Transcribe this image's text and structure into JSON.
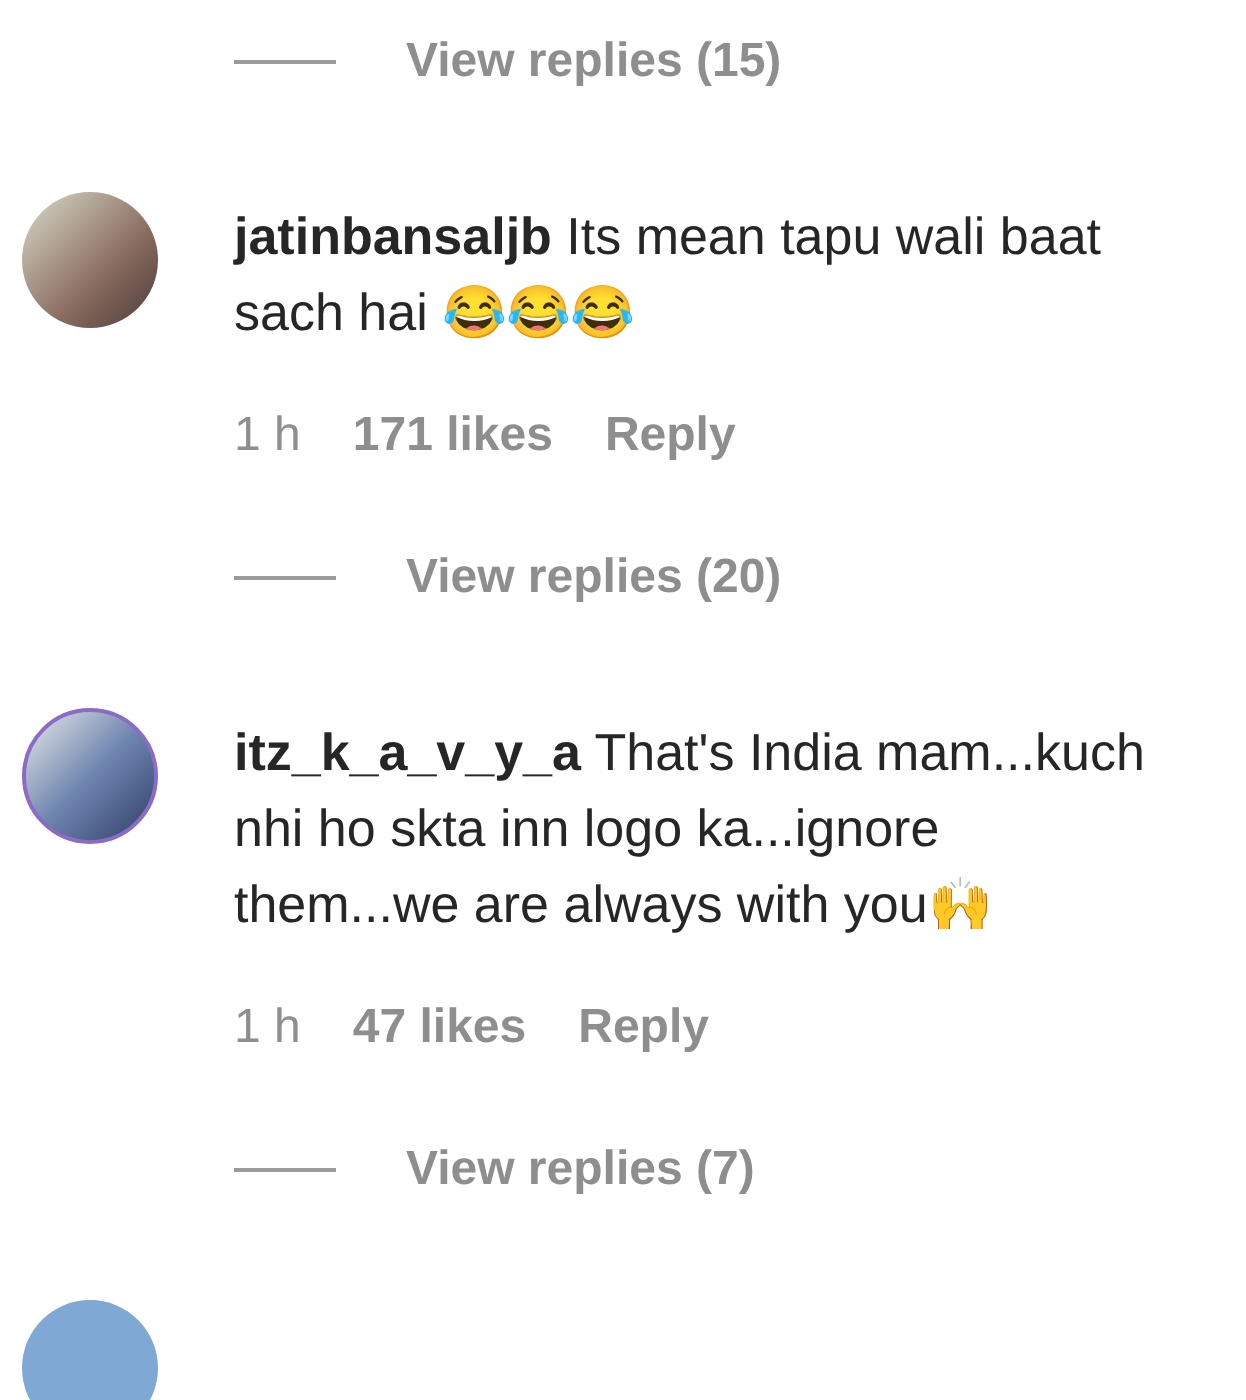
{
  "feed": [
    {
      "kind": "replies",
      "label": "View replies (15)"
    },
    {
      "kind": "comment",
      "username": "jatinbansaljb",
      "text": "Its mean tapu wali baat sach hai 😂😂😂",
      "story_ring": false,
      "time": "1 h",
      "likes": "171 likes",
      "reply": "Reply"
    },
    {
      "kind": "replies",
      "label": "View replies (20)"
    },
    {
      "kind": "comment",
      "username": "itz_k_a_v_y_a",
      "text": "That's India mam...kuch nhi ho skta inn logo ka...ignore them...we are always with you🙌",
      "story_ring": true,
      "time": "1 h",
      "likes": "47 likes",
      "reply": "Reply"
    },
    {
      "kind": "replies",
      "label": "View replies (7)"
    },
    {
      "kind": "avatar",
      "story_ring": false
    }
  ]
}
